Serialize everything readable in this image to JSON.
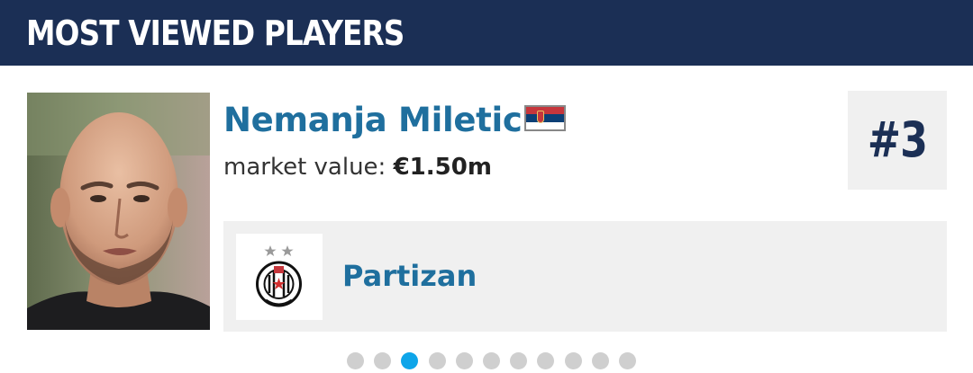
{
  "header": {
    "title": "MOST VIEWED PLAYERS"
  },
  "player": {
    "name": "Nemanja Miletic",
    "nationality_flag_icon": "serbia-flag-icon",
    "market_value_label": "market value:",
    "market_value": "€1.50m",
    "rank": "#3",
    "club": {
      "name": "Partizan",
      "logo_icon": "partizan-crest-icon"
    }
  },
  "carousel": {
    "total": 11,
    "active_index": 2
  },
  "colors": {
    "header_bg": "#1b2f55",
    "link_blue": "#1f6f9e",
    "active_dot": "#0ea5e9",
    "inactive_dot": "#cfcfcf",
    "panel_bg": "#f0f0f0"
  }
}
